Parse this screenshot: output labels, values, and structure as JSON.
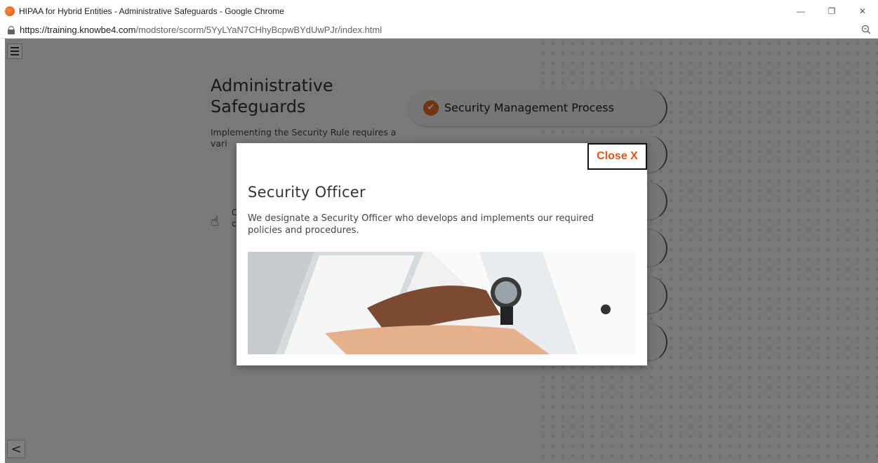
{
  "window": {
    "title": "HIPAA for Hybrid Entities - Administrative Safeguards - Google Chrome",
    "url_host": "https://training.knowbe4.com",
    "url_path": "/modstore/scorm/5YyLYaN7CHhyBcpwBYdUwPJr/index.html",
    "controls": {
      "minimize": "—",
      "restore": "❐",
      "close": "✕"
    }
  },
  "course": {
    "menu_icon": "hamburger-icon",
    "back_label": "<",
    "title": "Administrative Safeguards",
    "description": "Implementing the Security Rule requires a vari",
    "hint_fragment": "C o c",
    "topics": [
      {
        "label": "Security Management Process",
        "completed": true
      }
    ],
    "accent_color": "#e46a26"
  },
  "modal": {
    "close_label": "Close X",
    "title": "Security Officer",
    "body": "We designate a Security Officer who develops and implements our required policies and procedures.",
    "image_icon": "tablet-photo"
  }
}
